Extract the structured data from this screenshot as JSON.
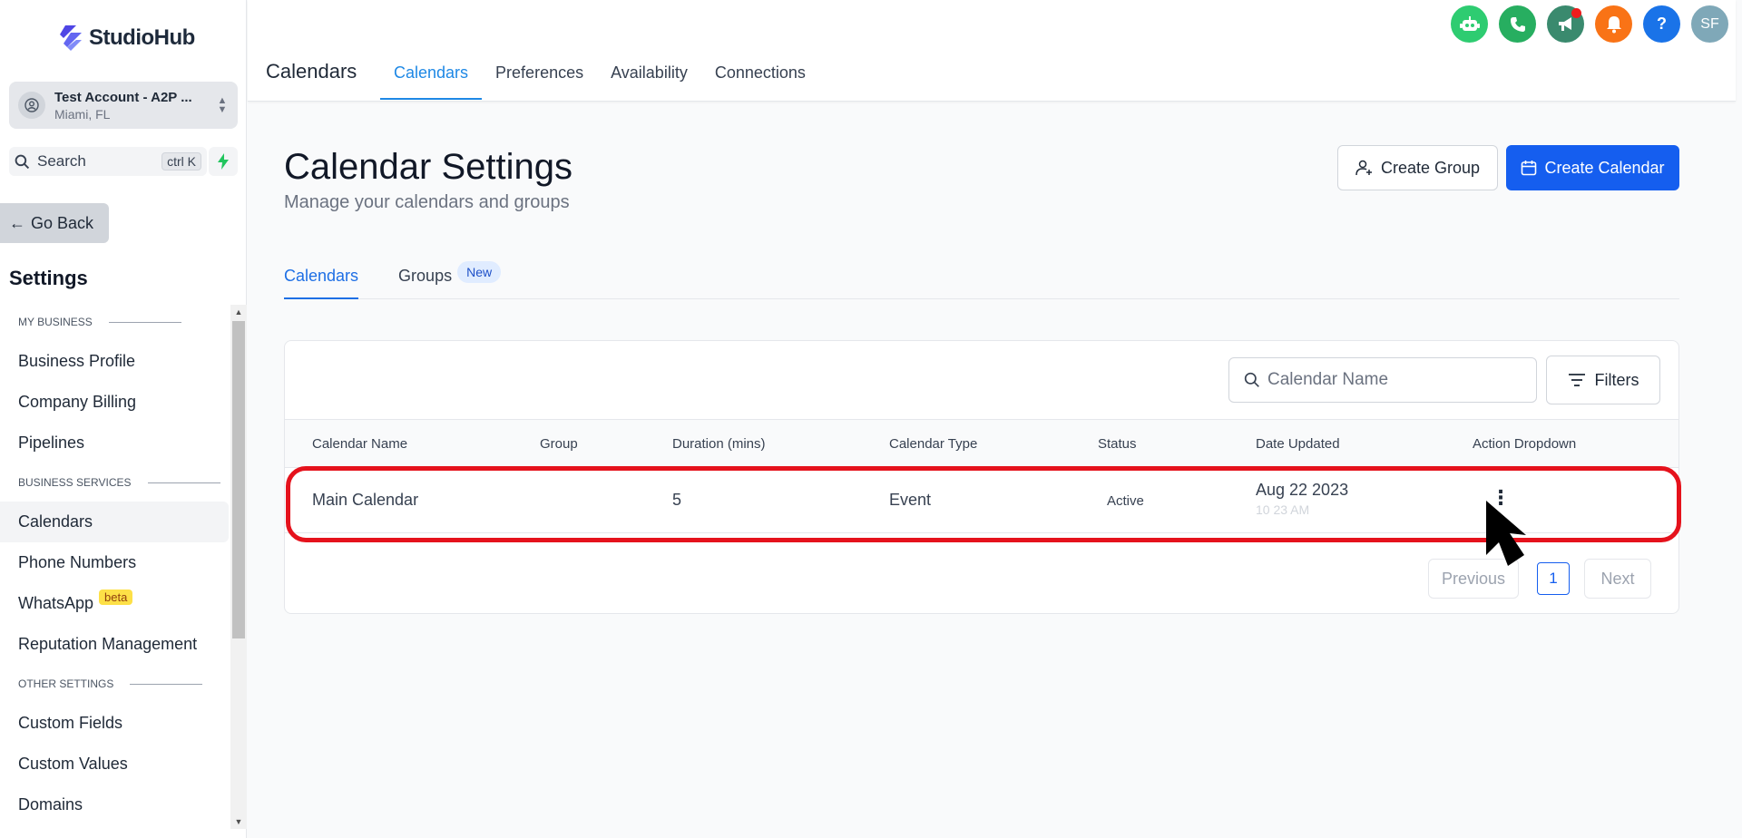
{
  "brand": {
    "name": "StudioHub"
  },
  "account": {
    "name": "Test Account - A2P ...",
    "location": "Miami, FL"
  },
  "search": {
    "label": "Search",
    "shortcut": "ctrl K"
  },
  "sidebar": {
    "go_back": "Go Back",
    "title": "Settings",
    "sections": [
      {
        "heading": "MY BUSINESS",
        "items": [
          "Business Profile",
          "Company Billing",
          "Pipelines"
        ]
      },
      {
        "heading": "BUSINESS SERVICES",
        "items": [
          "Calendars",
          "Phone Numbers",
          "WhatsApp",
          "Reputation Management"
        ]
      },
      {
        "heading": "OTHER SETTINGS",
        "items": [
          "Custom Fields",
          "Custom Values",
          "Domains"
        ]
      }
    ],
    "active_item": "Calendars",
    "whatsapp_badge": "beta"
  },
  "topbar": {
    "title": "Calendars",
    "tabs": [
      "Calendars",
      "Preferences",
      "Availability",
      "Connections"
    ],
    "active_tab": "Calendars",
    "icons": [
      {
        "name": "bot-icon",
        "color": "#2ecc71"
      },
      {
        "name": "phone-icon",
        "color": "#27ae60"
      },
      {
        "name": "megaphone-icon",
        "color": "#3a8a6e"
      },
      {
        "name": "bell-icon",
        "color": "#f97316"
      },
      {
        "name": "help-icon",
        "color": "#1a73e8"
      },
      {
        "name": "avatar",
        "color": "#7fa8b8",
        "text": "SF"
      }
    ]
  },
  "main": {
    "title": "Calendar Settings",
    "subtitle": "Manage your calendars and groups",
    "create_group": "Create Group",
    "create_calendar": "Create Calendar",
    "tabs": [
      "Calendars",
      "Groups"
    ],
    "groups_badge": "New",
    "search_placeholder": "Calendar Name",
    "filters": "Filters",
    "columns": [
      "Calendar Name",
      "Group",
      "Duration (mins)",
      "Calendar Type",
      "Status",
      "Date Updated",
      "Action Dropdown"
    ],
    "rows": [
      {
        "name": "Main Calendar",
        "group": "",
        "duration": "5",
        "type": "Event",
        "status": "Active",
        "date": "Aug 22 2023",
        "time": "10 23 AM"
      }
    ],
    "pagination": {
      "previous": "Previous",
      "current": "1",
      "next": "Next"
    }
  }
}
